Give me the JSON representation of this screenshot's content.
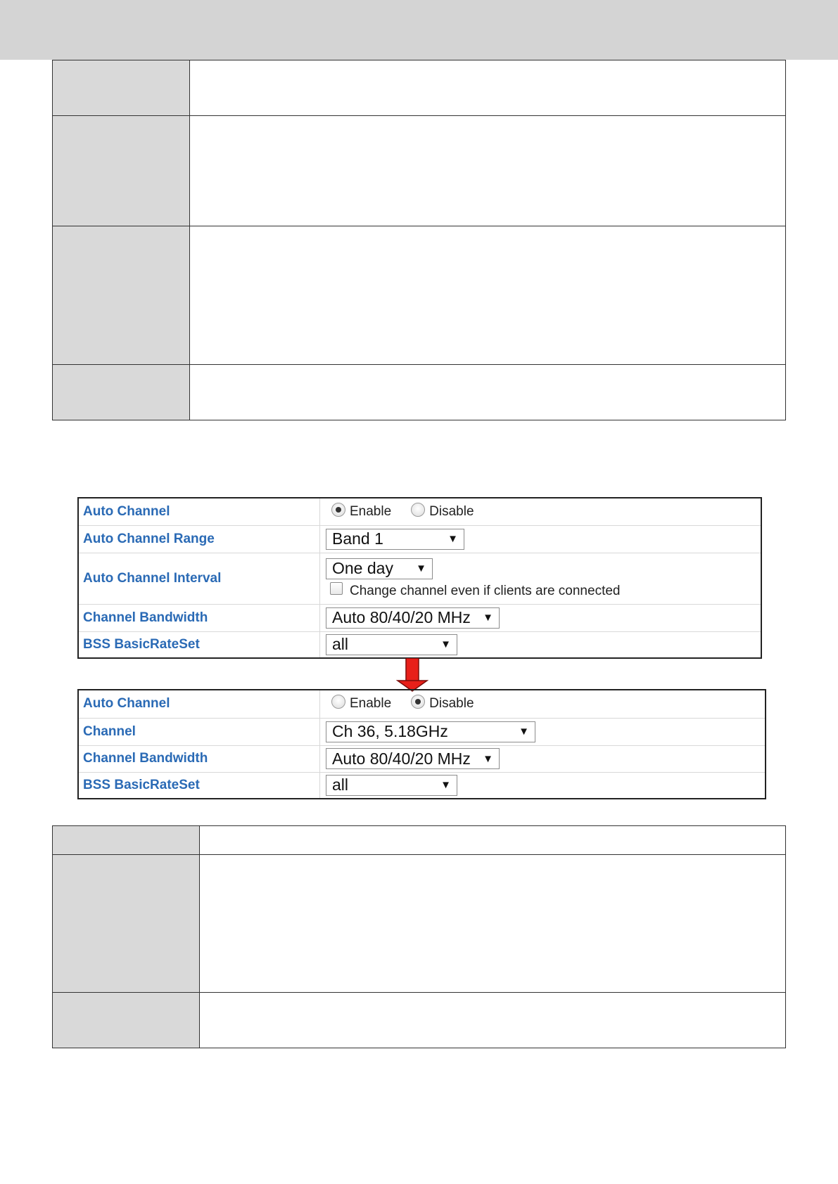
{
  "panel_before": {
    "auto_channel": {
      "label": "Auto Channel",
      "enable_label": "Enable",
      "disable_label": "Disable",
      "selected": "Enable"
    },
    "auto_channel_range": {
      "label": "Auto Channel Range",
      "value": "Band 1"
    },
    "auto_channel_interval": {
      "label": "Auto Channel Interval",
      "value": "One day",
      "checkbox_label": "Change channel even if clients are connected",
      "checkbox_checked": false
    },
    "channel_bandwidth": {
      "label": "Channel Bandwidth",
      "value": "Auto 80/40/20 MHz"
    },
    "bss_basic_rate_set": {
      "label": "BSS BasicRateSet",
      "value": "all"
    }
  },
  "transition_arrow": {
    "icon": "red-down-arrow",
    "color": "#e8201a"
  },
  "panel_after": {
    "auto_channel": {
      "label": "Auto Channel",
      "enable_label": "Enable",
      "disable_label": "Disable",
      "selected": "Disable"
    },
    "channel": {
      "label": "Channel",
      "value": "Ch 36, 5.18GHz"
    },
    "channel_bandwidth": {
      "label": "Channel Bandwidth",
      "value": "Auto 80/40/20 MHz"
    },
    "bss_basic_rate_set": {
      "label": "BSS BasicRateSet",
      "value": "all"
    }
  },
  "select_arrow_glyph": "▼",
  "colors": {
    "label_blue": "#2a6ab5",
    "header_band": "#d4d4d4",
    "table_label_fill": "#d9d9d9"
  }
}
